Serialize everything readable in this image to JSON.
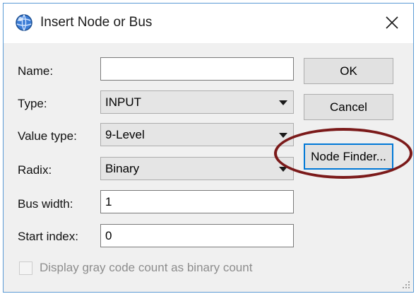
{
  "window": {
    "title": "Insert Node or Bus",
    "close_icon": "close-icon",
    "app_icon": "app-globe-icon"
  },
  "form": {
    "name": {
      "label": "Name:",
      "value": ""
    },
    "type": {
      "label": "Type:",
      "value": "INPUT"
    },
    "value_type": {
      "label": "Value type:",
      "value": "9-Level"
    },
    "radix": {
      "label": "Radix:",
      "value": "Binary"
    },
    "bus_width": {
      "label": "Bus width:",
      "value": "1"
    },
    "start_index": {
      "label": "Start index:",
      "value": "0"
    },
    "gray_code": {
      "label": "Display gray code count as binary count",
      "checked": false,
      "enabled": false
    }
  },
  "buttons": {
    "ok": "OK",
    "cancel": "Cancel",
    "node_finder": "Node Finder..."
  },
  "colors": {
    "focus_border": "#0078d7",
    "highlight_ellipse": "#7b1a1a",
    "window_border": "#5b9bd5"
  }
}
